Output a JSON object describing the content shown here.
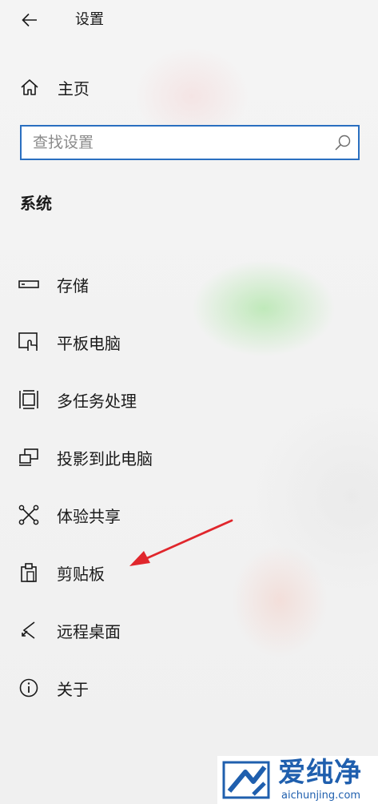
{
  "header": {
    "back_icon": "back-arrow-icon",
    "title": "设置"
  },
  "home": {
    "icon": "home-icon",
    "label": "主页"
  },
  "search": {
    "placeholder": "查找设置",
    "value": "",
    "icon": "search-icon"
  },
  "section": {
    "title": "系统"
  },
  "nav": {
    "items": [
      {
        "icon": "storage-icon",
        "label": "存储"
      },
      {
        "icon": "tablet-icon",
        "label": "平板电脑"
      },
      {
        "icon": "multitasking-icon",
        "label": "多任务处理"
      },
      {
        "icon": "project-icon",
        "label": "投影到此电脑"
      },
      {
        "icon": "shared-experiences-icon",
        "label": "体验共享"
      },
      {
        "icon": "clipboard-icon",
        "label": "剪贴板"
      },
      {
        "icon": "remote-desktop-icon",
        "label": "远程桌面"
      },
      {
        "icon": "info-icon",
        "label": "关于"
      }
    ]
  },
  "annotation": {
    "arrow_color": "#e0262c",
    "points_to": "剪贴板"
  },
  "watermark": {
    "title": "爱纯净",
    "url": "aichunjing.com",
    "color": "#1f5fae"
  },
  "colors": {
    "accent": "#2a6fc0",
    "text": "#1a1a1a"
  }
}
